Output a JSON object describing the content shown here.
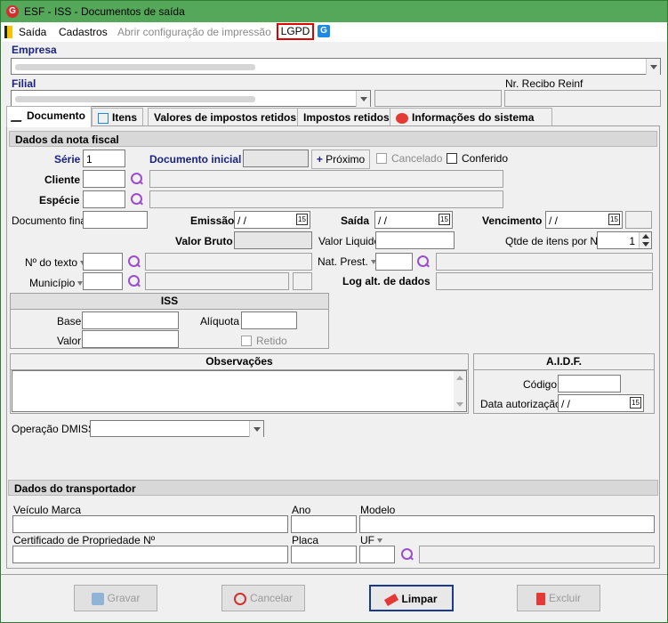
{
  "window": {
    "title": "ESF - ISS - Documentos de saída",
    "app_icon": "G"
  },
  "menu": {
    "saida": "Saída",
    "cadastros": "Cadastros",
    "abrir_config": "Abrir configuração de impressão",
    "lgpd": "LGPD",
    "help_icon": "G"
  },
  "header": {
    "empresa_label": "Empresa",
    "filial_label": "Filial",
    "recibo_label": "Nr. Recibo Reinf"
  },
  "tabs": [
    "Documento",
    "Itens",
    "Valores de impostos retidos",
    "Impostos retidos",
    "Informações do sistema"
  ],
  "nota": {
    "section": "Dados da nota fiscal",
    "serie_label": "Série",
    "serie_value": "1",
    "doc_inicial_label": "Documento inicial",
    "proximo_label": "Próximo",
    "cancelado_label": "Cancelado",
    "conferido_label": "Conferido",
    "cliente_label": "Cliente",
    "especie_label": "Espécie",
    "doc_final_label": "Documento final",
    "emissao_label": "Emissão",
    "emissao_value": " / /",
    "saida_label": "Saída",
    "saida_value": " / /",
    "vencimento_label": "Vencimento",
    "vencimento_value": " / /",
    "valor_bruto_label": "Valor Bruto",
    "valor_liquido_label": "Valor Liquido",
    "qtde_label": "Qtde de itens por NF",
    "qtde_value": "1",
    "nro_texto_label": "Nº do texto",
    "nat_prest_label": "Nat. Prest.",
    "municipio_label": "Município",
    "log_label": "Log alt. de dados",
    "cal_icon": "15"
  },
  "iss": {
    "title": "ISS",
    "base_label": "Base",
    "aliquota_label": "Alíquota",
    "valor_label": "Valor",
    "retido_label": "Retido"
  },
  "obs": {
    "title": "Observações"
  },
  "aidf": {
    "title": "A.I.D.F.",
    "codigo_label": "Código",
    "data_label": "Data autorização",
    "data_value": " / /"
  },
  "dmiss": {
    "label": "Operação DMISS"
  },
  "transp": {
    "section": "Dados do transportador",
    "veiculo_label": "Veículo Marca",
    "ano_label": "Ano",
    "modelo_label": "Modelo",
    "certificado_label": "Certificado de Propriedade Nº",
    "placa_label": "Placa",
    "uf_label": "UF"
  },
  "buttons": {
    "gravar": "Gravar",
    "cancelar": "Cancelar",
    "limpar": "Limpar",
    "excluir": "Excluir"
  },
  "colors": {
    "titlebar": "#55a75a",
    "lgpd_border": "#e00000",
    "label_blue": "#1a237e"
  }
}
